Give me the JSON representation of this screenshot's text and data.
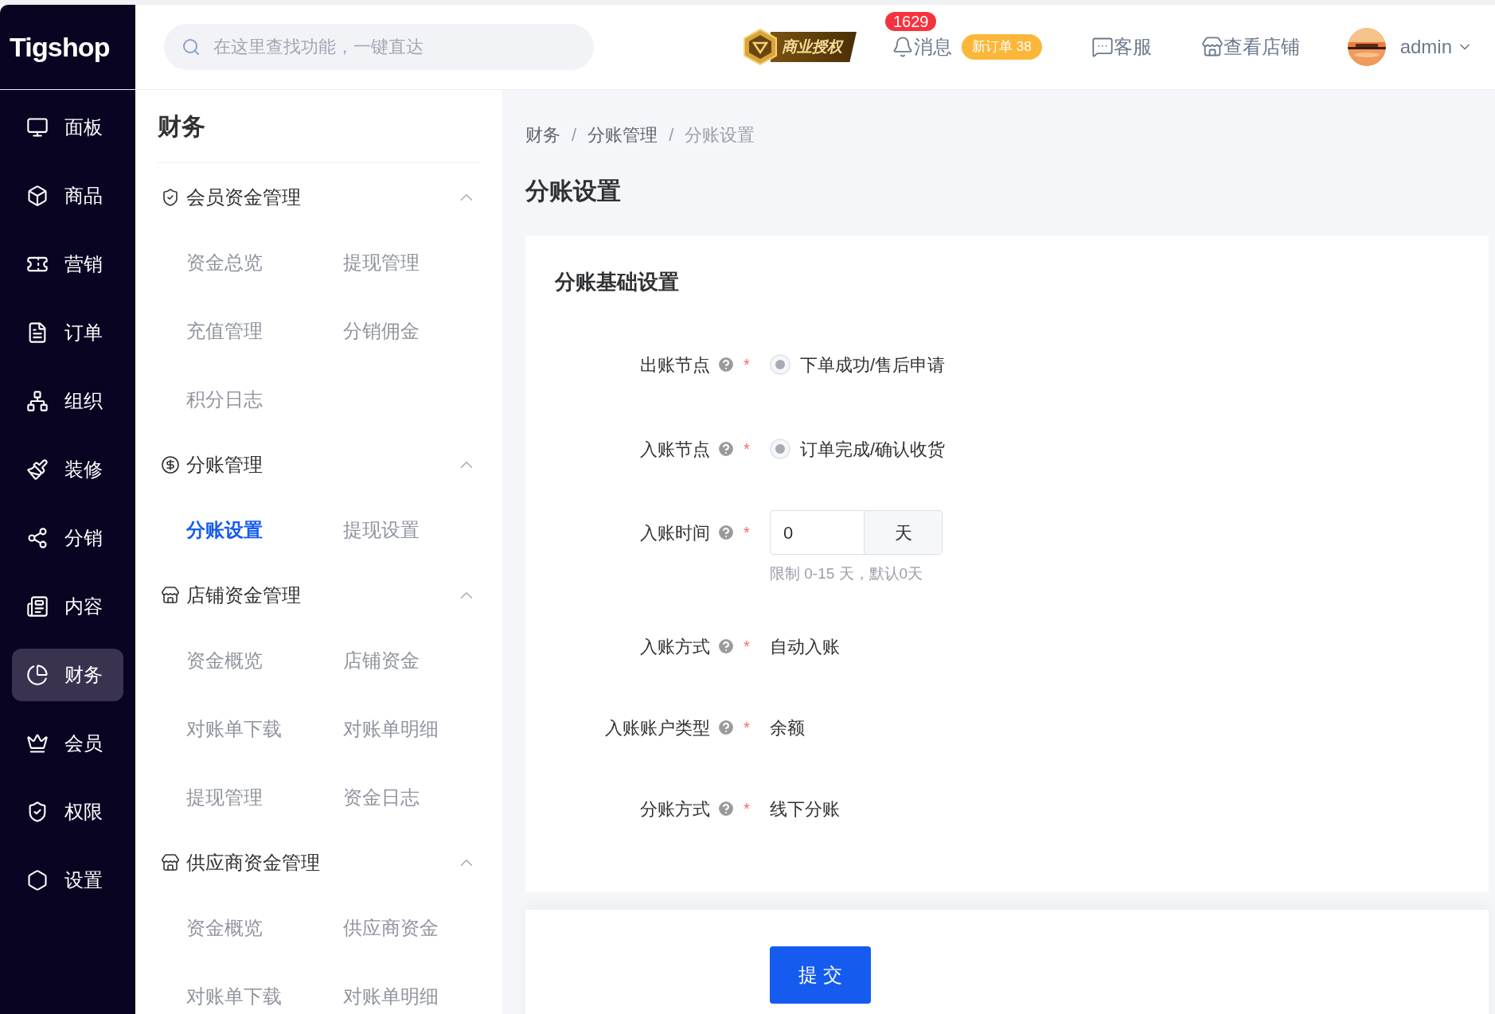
{
  "brand": {
    "logo": "Tigshop"
  },
  "search": {
    "placeholder": "在这里查找功能，一键直达"
  },
  "header": {
    "license_badge": "商业授权",
    "messages": {
      "label": "消息",
      "count": "1629"
    },
    "new_orders": "新订单 38",
    "service": "客服",
    "view_store": "查看店铺",
    "user": "admin"
  },
  "nav": [
    {
      "label": "面板",
      "selected": false
    },
    {
      "label": "商品",
      "selected": false
    },
    {
      "label": "营销",
      "selected": false
    },
    {
      "label": "订单",
      "selected": false
    },
    {
      "label": "组织",
      "selected": false
    },
    {
      "label": "装修",
      "selected": false
    },
    {
      "label": "分销",
      "selected": false
    },
    {
      "label": "内容",
      "selected": false
    },
    {
      "label": "财务",
      "selected": true
    },
    {
      "label": "会员",
      "selected": false
    },
    {
      "label": "权限",
      "selected": false
    },
    {
      "label": "设置",
      "selected": false
    }
  ],
  "submenu": {
    "title": "财务",
    "groups": [
      {
        "title": "会员资金管理",
        "expanded": true,
        "items": [
          {
            "label": "资金总览",
            "selected": false
          },
          {
            "label": "提现管理",
            "selected": false
          },
          {
            "label": "充值管理",
            "selected": false
          },
          {
            "label": "分销佣金",
            "selected": false
          },
          {
            "label": "积分日志",
            "selected": false
          }
        ]
      },
      {
        "title": "分账管理",
        "expanded": true,
        "items": [
          {
            "label": "分账设置",
            "selected": true
          },
          {
            "label": "提现设置",
            "selected": false
          }
        ]
      },
      {
        "title": "店铺资金管理",
        "expanded": true,
        "items": [
          {
            "label": "资金概览",
            "selected": false
          },
          {
            "label": "店铺资金",
            "selected": false
          },
          {
            "label": "对账单下载",
            "selected": false
          },
          {
            "label": "对账单明细",
            "selected": false
          },
          {
            "label": "提现管理",
            "selected": false
          },
          {
            "label": "资金日志",
            "selected": false
          }
        ]
      },
      {
        "title": "供应商资金管理",
        "expanded": true,
        "items": [
          {
            "label": "资金概览",
            "selected": false
          },
          {
            "label": "供应商资金",
            "selected": false
          },
          {
            "label": "对账单下载",
            "selected": false
          },
          {
            "label": "对账单明细",
            "selected": false
          }
        ]
      }
    ]
  },
  "breadcrumb": [
    {
      "kind": "link",
      "text": "财务"
    },
    {
      "kind": "separator",
      "text": "/"
    },
    {
      "kind": "link",
      "text": "分账管理"
    },
    {
      "kind": "separator",
      "text": "/"
    },
    {
      "kind": "current",
      "text": "分账设置"
    }
  ],
  "page_title": "分账设置",
  "card": {
    "title": "分账基础设置",
    "fields": [
      {
        "kind": "radio",
        "label": "出账节点",
        "required_mark": "*",
        "option": "下单成功/售后申请",
        "checked": true,
        "disabled": true
      },
      {
        "kind": "radio",
        "label": "入账节点",
        "required_mark": "*",
        "option": "订单完成/确认收货",
        "checked": true,
        "disabled": true
      },
      {
        "kind": "input",
        "label": "入账时间",
        "required_mark": "*",
        "value": "0",
        "suffix": "天",
        "hint": "限制 0-15 天，默认0天"
      },
      {
        "kind": "text",
        "label": "入账方式",
        "required_mark": "*",
        "value": "自动入账"
      },
      {
        "kind": "text",
        "label": "入账账户类型",
        "required_mark": "*",
        "value": "余额"
      },
      {
        "kind": "text",
        "label": "分账方式",
        "required_mark": "*",
        "value": "线下分账"
      }
    ]
  },
  "submit": "提 交"
}
